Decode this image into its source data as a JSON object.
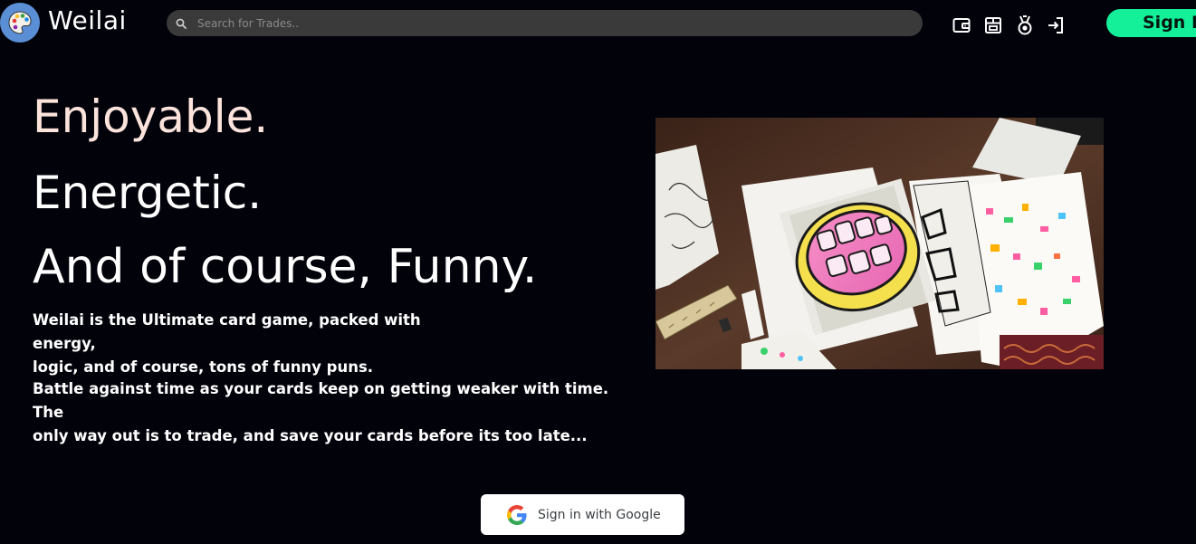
{
  "header": {
    "brand": "Weilai",
    "search_placeholder": "Search for Trades..",
    "nav_icons": [
      "wallet-icon",
      "store-icon",
      "medal-icon",
      "login-icon"
    ],
    "signin_label": "Sign In"
  },
  "hero": {
    "line1": "Enjoyable.",
    "line2": "Energetic.",
    "line3": "And of course, Funny.",
    "para1_line1": "Weilai is the Ultimate card game, packed with energy,",
    "para1_line2": "logic, and of course, tons of funny puns.",
    "para2_line1": "Battle against time as your cards keep on getting weaker with time. The",
    "para2_line2": "only way out is to trade, and save your cards before its too late...",
    "image": "graffiti-sketches-photo"
  },
  "google_signin": {
    "label": "Sign in with Google"
  },
  "colors": {
    "background": "#02020a",
    "accent": "#14f09a",
    "headline_peach": "#fce3dc",
    "search_bg": "#3a3a3a"
  }
}
